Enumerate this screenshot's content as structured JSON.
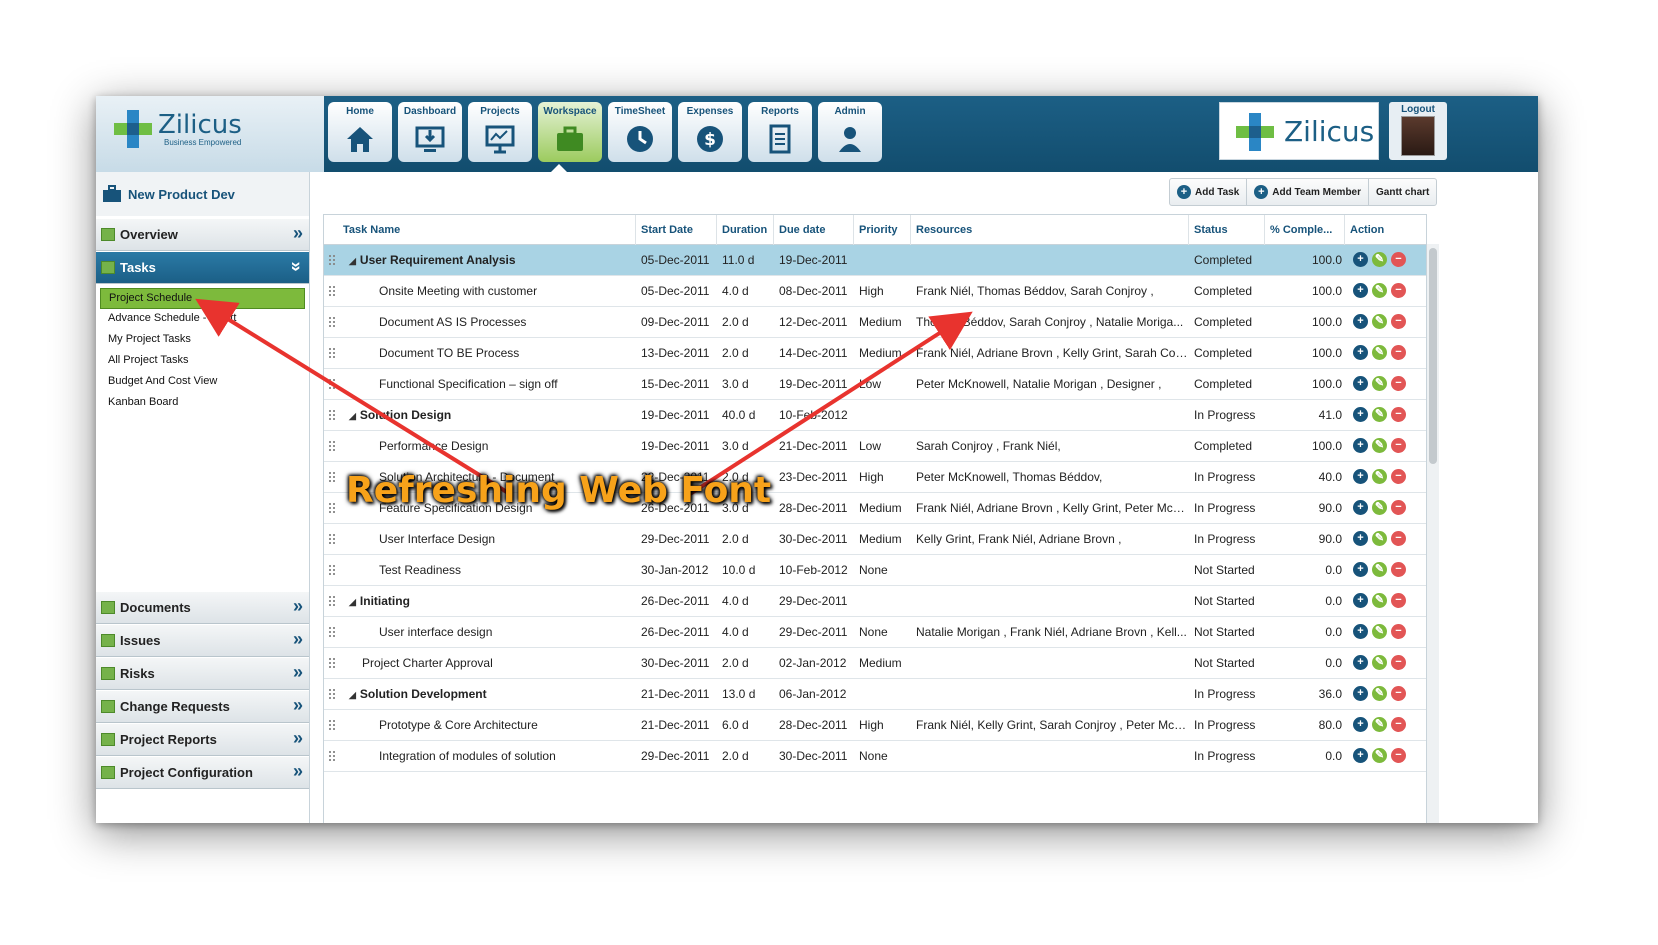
{
  "brand": {
    "name": "Zilicus",
    "tagline": "Business Empowered",
    "logout": "Logout"
  },
  "nav": [
    "Home",
    "Dashboard",
    "Projects",
    "Workspace",
    "TimeSheet",
    "Expenses",
    "Reports",
    "Admin"
  ],
  "project": {
    "name": "New Product Dev"
  },
  "sidebar": {
    "overview": "Overview",
    "tasks": "Tasks",
    "task_items": [
      "Project Schedule",
      "Advance Schedule - Gantt",
      "My Project Tasks",
      "All Project Tasks",
      "Budget And Cost View",
      "Kanban Board"
    ],
    "sections": [
      "Documents",
      "Issues",
      "Risks",
      "Change Requests",
      "Project Reports",
      "Project Configuration"
    ]
  },
  "toolbar": {
    "add_task": "Add Task",
    "add_team_member": "Add Team Member",
    "gantt_chart": "Gantt chart"
  },
  "columns": [
    "Task Name",
    "Start Date",
    "Duration",
    "Due date",
    "Priority",
    "Resources",
    "Status",
    "% Comple...",
    "Action"
  ],
  "rows": [
    {
      "name": "User Requirement Analysis",
      "group": true,
      "start": "05-Dec-2011",
      "duration": "11.0 d",
      "due": "19-Dec-2011",
      "priority": "",
      "resources": "",
      "status": "Completed",
      "pct": "100.0"
    },
    {
      "name": "Onsite Meeting with customer",
      "group": false,
      "start": "05-Dec-2011",
      "duration": "4.0 d",
      "due": "08-Dec-2011",
      "priority": "High",
      "resources": "Frank Niél, Thomas Béddov, Sarah Conjroy ,",
      "status": "Completed",
      "pct": "100.0"
    },
    {
      "name": "Document AS IS Processes",
      "group": false,
      "start": "09-Dec-2011",
      "duration": "2.0 d",
      "due": "12-Dec-2011",
      "priority": "Medium",
      "resources": "Thomas Béddov, Sarah Conjroy , Natalie Moriga...",
      "status": "Completed",
      "pct": "100.0"
    },
    {
      "name": "Document TO BE Process",
      "group": false,
      "start": "13-Dec-2011",
      "duration": "2.0 d",
      "due": "14-Dec-2011",
      "priority": "Medium",
      "resources": "Frank Niél, Adriane Brovn , Kelly Grint, Sarah Con...",
      "status": "Completed",
      "pct": "100.0"
    },
    {
      "name": "Functional Specification – sign off",
      "group": false,
      "start": "15-Dec-2011",
      "duration": "3.0 d",
      "due": "19-Dec-2011",
      "priority": "Low",
      "resources": "Peter McKnowell, Natalie Morigan , Designer ,",
      "status": "Completed",
      "pct": "100.0"
    },
    {
      "name": "Solution Design",
      "group": true,
      "start": "19-Dec-2011",
      "duration": "40.0 d",
      "due": "10-Feb-2012",
      "priority": "",
      "resources": "",
      "status": "In Progress",
      "pct": "41.0"
    },
    {
      "name": "Performance Design",
      "group": false,
      "start": "19-Dec-2011",
      "duration": "3.0 d",
      "due": "21-Dec-2011",
      "priority": "Low",
      "resources": "Sarah Conjroy , Frank Niél,",
      "status": "Completed",
      "pct": "100.0"
    },
    {
      "name": "Solution Architecture - Document",
      "group": false,
      "start": "22-Dec-2011",
      "duration": "2.0 d",
      "due": "23-Dec-2011",
      "priority": "High",
      "resources": "Peter McKnowell, Thomas Béddov,",
      "status": "In Progress",
      "pct": "40.0"
    },
    {
      "name": "Feature Specification Design",
      "group": false,
      "start": "26-Dec-2011",
      "duration": "3.0 d",
      "due": "28-Dec-2011",
      "priority": "Medium",
      "resources": "Frank Niél, Adriane Brovn , Kelly Grint, Peter McK...",
      "status": "In Progress",
      "pct": "90.0"
    },
    {
      "name": "User Interface Design",
      "group": false,
      "start": "29-Dec-2011",
      "duration": "2.0 d",
      "due": "30-Dec-2011",
      "priority": "Medium",
      "resources": "Kelly Grint, Frank Niél, Adriane Brovn ,",
      "status": "In Progress",
      "pct": "90.0"
    },
    {
      "name": "Test Readiness",
      "group": false,
      "start": "30-Jan-2012",
      "duration": "10.0 d",
      "due": "10-Feb-2012",
      "priority": "None",
      "resources": "",
      "status": "Not Started",
      "pct": "0.0"
    },
    {
      "name": "Initiating",
      "group": true,
      "start": "26-Dec-2011",
      "duration": "4.0 d",
      "due": "29-Dec-2011",
      "priority": "",
      "resources": "",
      "status": "Not Started",
      "pct": "0.0"
    },
    {
      "name": "User interface design",
      "group": false,
      "start": "26-Dec-2011",
      "duration": "4.0 d",
      "due": "29-Dec-2011",
      "priority": "None",
      "resources": "Natalie Morigan , Frank Niél, Adriane Brovn , Kell...",
      "status": "Not Started",
      "pct": "0.0"
    },
    {
      "name": "Project Charter Approval",
      "group": false,
      "top": true,
      "start": "30-Dec-2011",
      "duration": "2.0 d",
      "due": "02-Jan-2012",
      "priority": "Medium",
      "resources": "",
      "status": "Not Started",
      "pct": "0.0"
    },
    {
      "name": "Solution Development",
      "group": true,
      "start": "21-Dec-2011",
      "duration": "13.0 d",
      "due": "06-Jan-2012",
      "priority": "",
      "resources": "",
      "status": "In Progress",
      "pct": "36.0"
    },
    {
      "name": "Prototype & Core Architecture",
      "group": false,
      "start": "21-Dec-2011",
      "duration": "6.0 d",
      "due": "28-Dec-2011",
      "priority": "High",
      "resources": "Frank Niél, Kelly Grint, Sarah Conjroy , Peter McK...",
      "status": "In Progress",
      "pct": "80.0"
    },
    {
      "name": "Integration of modules of solution",
      "group": false,
      "start": "29-Dec-2011",
      "duration": "2.0 d",
      "due": "30-Dec-2011",
      "priority": "None",
      "resources": "",
      "status": "In Progress",
      "pct": "0.0"
    }
  ],
  "annotation": {
    "text": "Refreshing Web Font"
  },
  "colors": {
    "brand_blue": "#1c5f85",
    "active_green": "#7dba3c",
    "highlight_row": "#a9d3e4",
    "arrow_red": "#e8332e",
    "banner_orange": "#f7a21a"
  }
}
